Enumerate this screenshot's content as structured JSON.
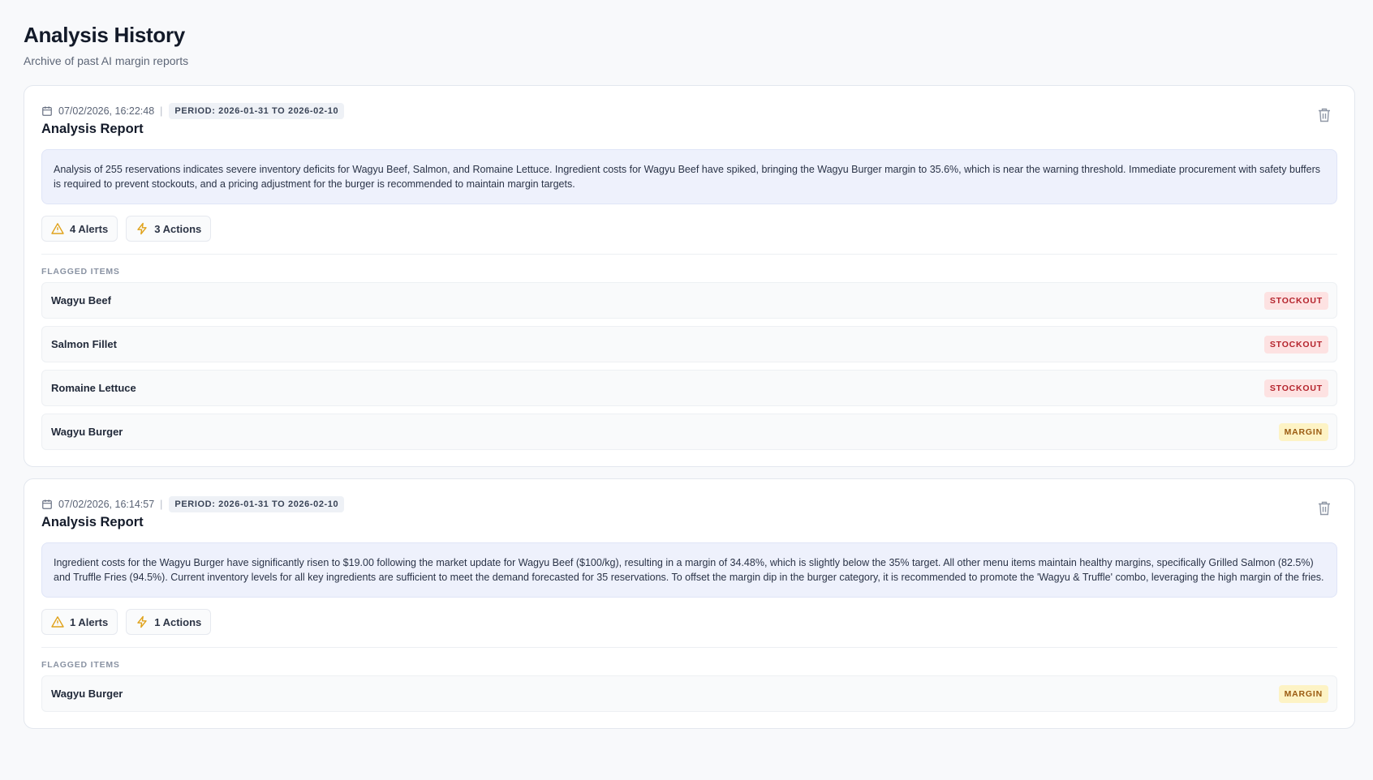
{
  "header": {
    "title": "Analysis History",
    "subtitle": "Archive of past AI margin reports"
  },
  "colors": {
    "stockout_bg": "#fde2e2",
    "stockout_text": "#b4232c",
    "margin_bg": "#fdf3c5",
    "margin_text": "#9a5a10",
    "alert_icon": "#e0a21b"
  },
  "reports": [
    {
      "timestamp": "07/02/2026, 16:22:48",
      "period": "PERIOD: 2026-01-31 TO 2026-02-10",
      "title": "Analysis Report",
      "summary": "Analysis of 255 reservations indicates severe inventory deficits for Wagyu Beef, Salmon, and Romaine Lettuce. Ingredient costs for Wagyu Beef have spiked, bringing the Wagyu Burger margin to 35.6%, which is near the warning threshold. Immediate procurement with safety buffers is required to prevent stockouts, and a pricing adjustment for the burger is recommended to maintain margin targets.",
      "alerts_label": "4 Alerts",
      "actions_label": "3 Actions",
      "flagged_heading": "FLAGGED ITEMS",
      "flagged": [
        {
          "name": "Wagyu Beef",
          "tag": "STOCKOUT"
        },
        {
          "name": "Salmon Fillet",
          "tag": "STOCKOUT"
        },
        {
          "name": "Romaine Lettuce",
          "tag": "STOCKOUT"
        },
        {
          "name": "Wagyu Burger",
          "tag": "MARGIN"
        }
      ]
    },
    {
      "timestamp": "07/02/2026, 16:14:57",
      "period": "PERIOD: 2026-01-31 TO 2026-02-10",
      "title": "Analysis Report",
      "summary": "Ingredient costs for the Wagyu Burger have significantly risen to $19.00 following the market update for Wagyu Beef ($100/kg), resulting in a margin of 34.48%, which is slightly below the 35% target. All other menu items maintain healthy margins, specifically Grilled Salmon (82.5%) and Truffle Fries (94.5%). Current inventory levels for all key ingredients are sufficient to meet the demand forecasted for 35 reservations. To offset the margin dip in the burger category, it is recommended to promote the 'Wagyu & Truffle' combo, leveraging the high margin of the fries.",
      "alerts_label": "1 Alerts",
      "actions_label": "1 Actions",
      "flagged_heading": "FLAGGED ITEMS",
      "flagged": [
        {
          "name": "Wagyu Burger",
          "tag": "MARGIN"
        }
      ]
    }
  ]
}
